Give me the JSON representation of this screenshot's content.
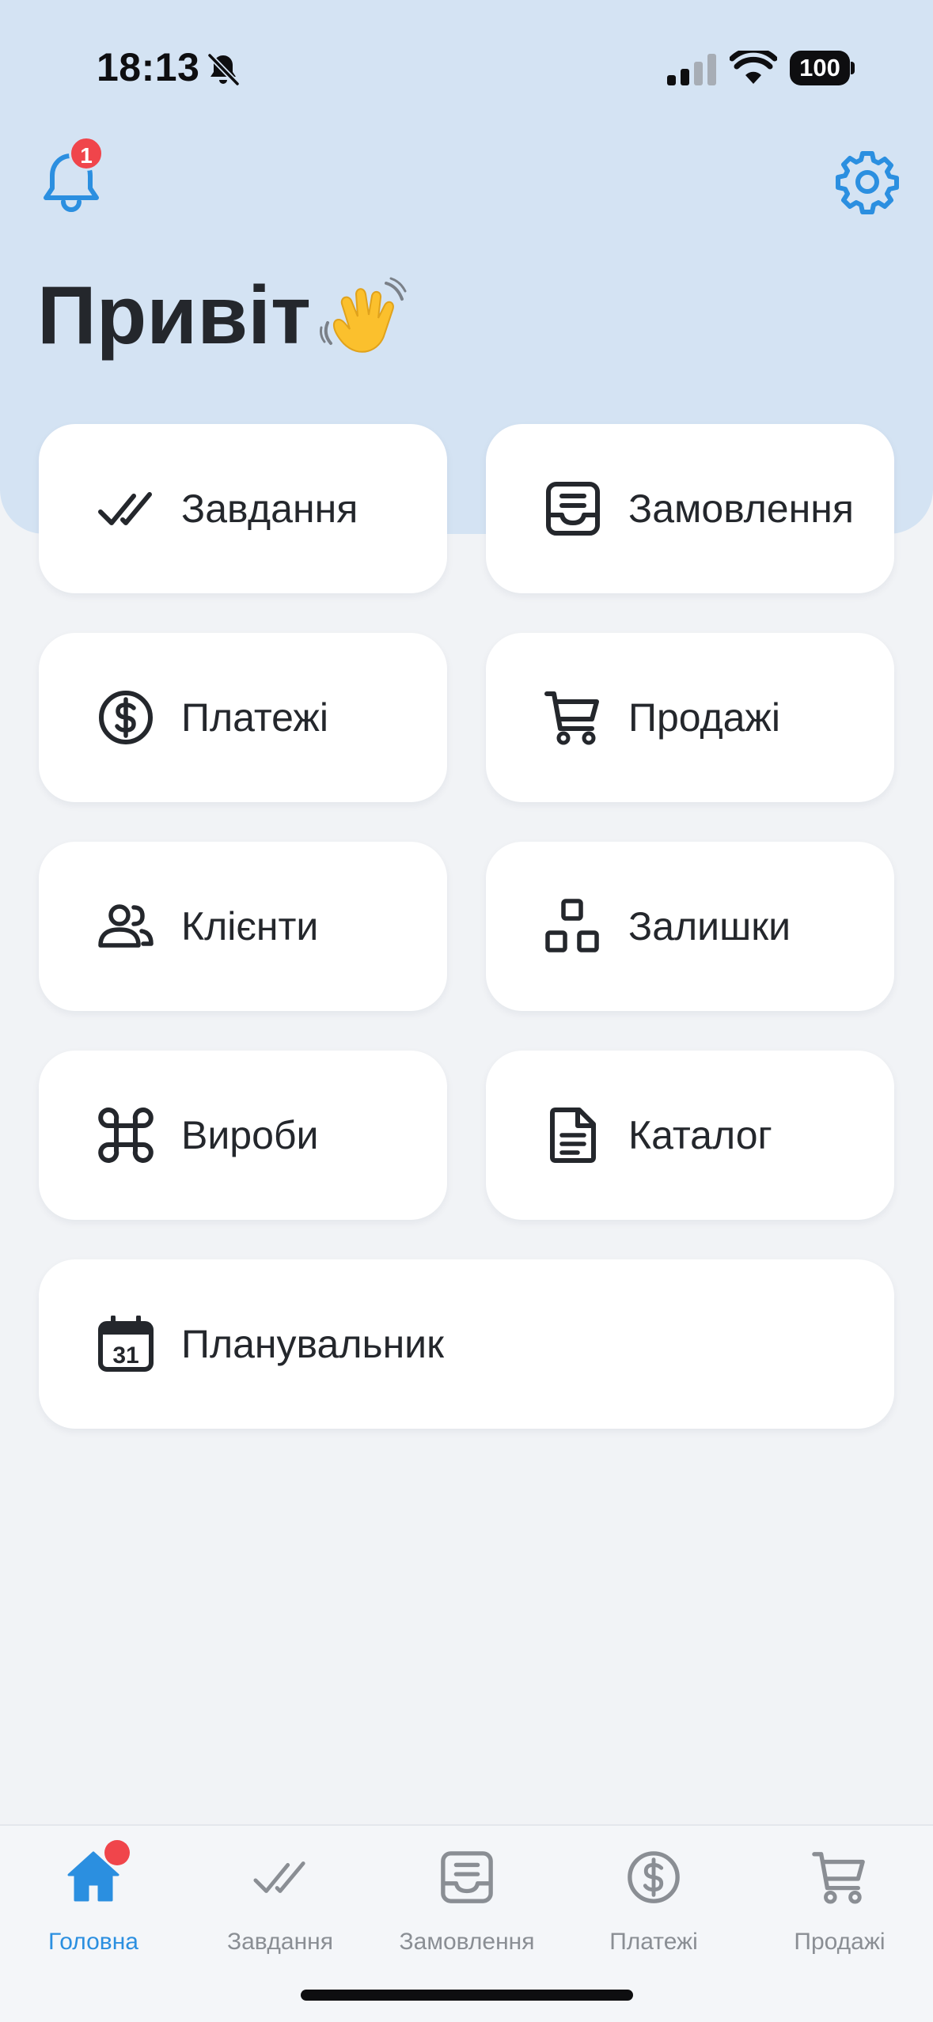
{
  "status_bar": {
    "time": "18:13",
    "battery": "100"
  },
  "header": {
    "notification_count": "1",
    "greeting": "Привіт"
  },
  "tiles": [
    {
      "label": "Завдання",
      "icon": "check-icon"
    },
    {
      "label": "Замовлення",
      "icon": "inbox-icon"
    },
    {
      "label": "Платежі",
      "icon": "dollar-circle-icon"
    },
    {
      "label": "Продажі",
      "icon": "cart-icon"
    },
    {
      "label": "Клієнти",
      "icon": "users-icon"
    },
    {
      "label": "Залишки",
      "icon": "blocks-icon"
    },
    {
      "label": "Вироби",
      "icon": "command-icon"
    },
    {
      "label": "Каталог",
      "icon": "document-icon"
    },
    {
      "label": "Планувальник",
      "icon": "calendar-icon"
    }
  ],
  "calendar_day": "31",
  "tabbar": {
    "items": [
      {
        "label": "Головна",
        "icon": "home-icon",
        "active": true
      },
      {
        "label": "Завдання",
        "icon": "check-icon",
        "active": false
      },
      {
        "label": "Замовлення",
        "icon": "inbox-icon",
        "active": false
      },
      {
        "label": "Платежі",
        "icon": "dollar-circle-icon",
        "active": false
      },
      {
        "label": "Продажі",
        "icon": "cart-icon",
        "active": false
      }
    ]
  },
  "colors": {
    "accent": "#2B8FE0",
    "header_bg": "#D4E3F3",
    "badge": "#F0454B",
    "page_bg": "#F1F3F6",
    "text": "#24272C",
    "tab_inactive": "#8A8E94"
  }
}
